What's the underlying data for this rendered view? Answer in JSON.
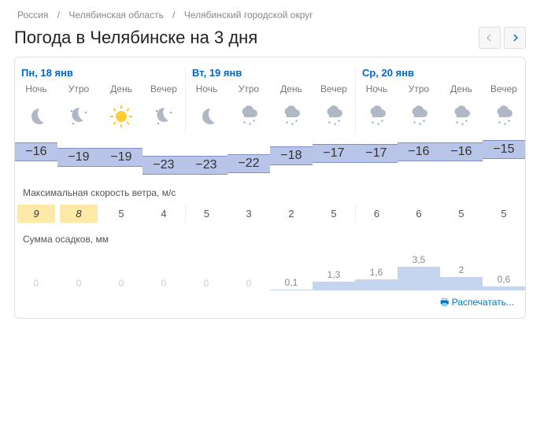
{
  "breadcrumb": {
    "parts": [
      "Россия",
      "Челябинская область",
      "Челябинский городской округ"
    ],
    "sep": "/"
  },
  "title": "Погода в Челябинске на 3 дня",
  "days": [
    {
      "label": "Пн, 18 янв",
      "color": "blue"
    },
    {
      "label": "Вт, 19 янв",
      "color": "blue"
    },
    {
      "label": "Ср, 20 янв",
      "color": "blue"
    }
  ],
  "parts": [
    "Ночь",
    "Утро",
    "День",
    "Вечер"
  ],
  "icons": [
    "moon",
    "moon-stars",
    "sun",
    "moon-stars",
    "moon",
    "snow",
    "snow",
    "snow",
    "snow",
    "snow",
    "snow",
    "snow"
  ],
  "temps": [
    -16,
    -19,
    -19,
    -23,
    -23,
    -22,
    -18,
    -17,
    -17,
    -16,
    -16,
    -15
  ],
  "wind_label": "Максимальная скорость ветра, м/с",
  "winds": [
    {
      "v": 9,
      "warn": true
    },
    {
      "v": 8,
      "warn": true
    },
    {
      "v": 5,
      "warn": false
    },
    {
      "v": 4,
      "warn": false
    },
    {
      "v": 5,
      "warn": false
    },
    {
      "v": 3,
      "warn": false
    },
    {
      "v": 2,
      "warn": false
    },
    {
      "v": 5,
      "warn": false
    },
    {
      "v": 6,
      "warn": false
    },
    {
      "v": 6,
      "warn": false
    },
    {
      "v": 5,
      "warn": false
    },
    {
      "v": 5,
      "warn": false
    }
  ],
  "precip_label": "Сумма осадков, мм",
  "precip": [
    0,
    0,
    0,
    0,
    0,
    0,
    0.1,
    1.3,
    1.6,
    3.5,
    2,
    0.6
  ],
  "print": "Распечатать..."
}
